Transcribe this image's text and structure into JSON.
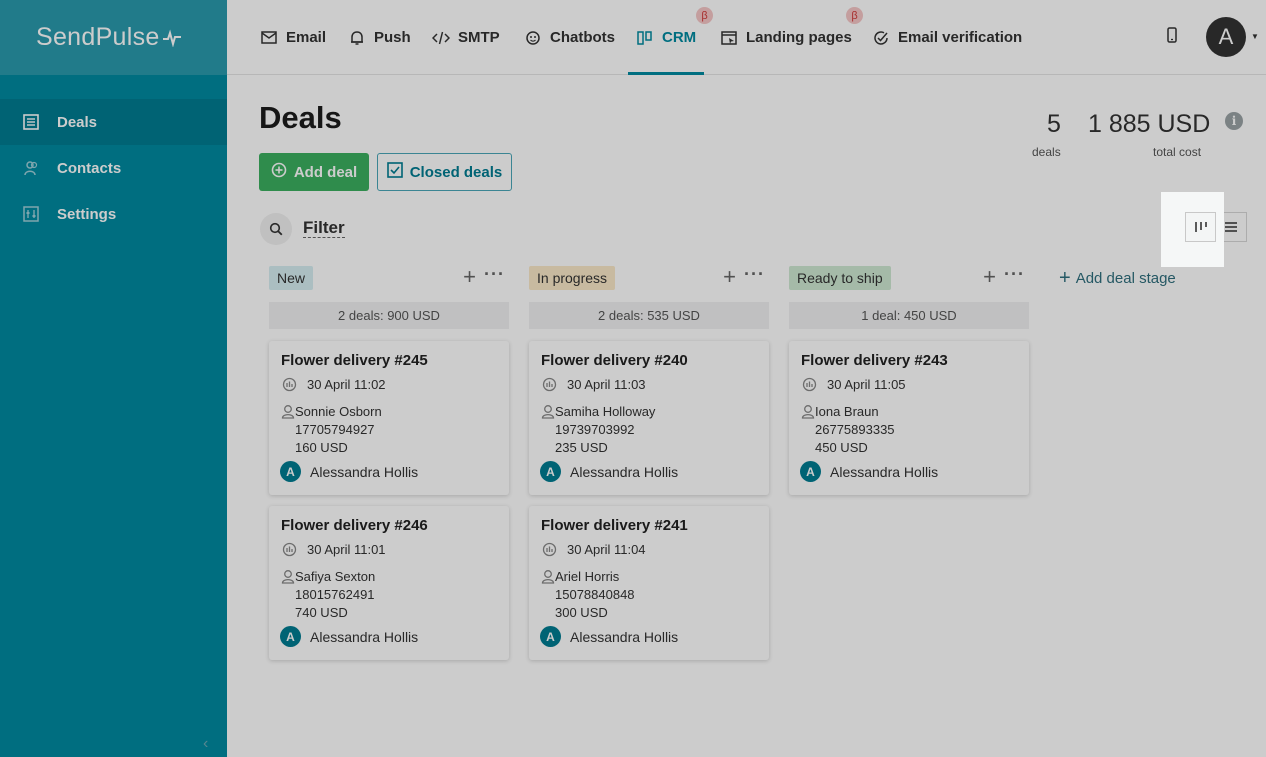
{
  "brand": {
    "name": "SendPulse"
  },
  "sidebar": {
    "items": [
      {
        "label": "Deals",
        "icon": "deals-list-icon"
      },
      {
        "label": "Contacts",
        "icon": "contacts-icon"
      },
      {
        "label": "Settings",
        "icon": "settings-sliders-icon"
      }
    ]
  },
  "topnav": {
    "tabs": [
      {
        "label": "Email",
        "icon": "envelope-icon"
      },
      {
        "label": "Push",
        "icon": "bell-icon"
      },
      {
        "label": "SMTP",
        "icon": "code-icon"
      },
      {
        "label": "Chatbots",
        "icon": "chatbot-icon"
      },
      {
        "label": "CRM",
        "icon": "crm-icon",
        "beta": "β"
      },
      {
        "label": "Landing pages",
        "icon": "landing-icon",
        "beta": "β"
      },
      {
        "label": "Email verification",
        "icon": "check-circle-icon"
      }
    ],
    "avatar_letter": "A"
  },
  "page": {
    "title": "Deals",
    "add_deal": "Add deal",
    "closed_deals": "Closed deals",
    "filter": "Filter",
    "add_stage": "Add deal stage"
  },
  "stats": {
    "deals_count": "5",
    "deals_label": "deals",
    "total_cost": "1 885 USD",
    "total_label": "total cost"
  },
  "columns": [
    {
      "name": "New",
      "color": "#d6eef2",
      "summary": "2 deals: 900 USD",
      "cards": [
        {
          "title": "Flower delivery #245",
          "date": "30 April 11:02",
          "contact": "Sonnie Osborn",
          "phone": "17705794927",
          "amount": "160 USD",
          "owner": "Alessandra Hollis",
          "owner_initial": "A"
        },
        {
          "title": "Flower delivery #246",
          "date": "30 April 11:01",
          "contact": "Safiya Sexton",
          "phone": "18015762491",
          "amount": "740 USD",
          "owner": "Alessandra Hollis",
          "owner_initial": "A"
        }
      ]
    },
    {
      "name": "In progress",
      "color": "#fbe9c8",
      "summary": "2 deals: 535 USD",
      "cards": [
        {
          "title": "Flower delivery #240",
          "date": "30 April 11:03",
          "contact": "Samiha Holloway",
          "phone": "19739703992",
          "amount": "235 USD",
          "owner": "Alessandra Hollis",
          "owner_initial": "A"
        },
        {
          "title": "Flower delivery #241",
          "date": "30 April 11:04",
          "contact": "Ariel Horris",
          "phone": "15078840848",
          "amount": "300 USD",
          "owner": "Alessandra Hollis",
          "owner_initial": "A"
        }
      ]
    },
    {
      "name": "Ready to ship",
      "color": "#cfe9d3",
      "summary": "1 deal: 450 USD",
      "cards": [
        {
          "title": "Flower delivery #243",
          "date": "30 April 11:05",
          "contact": "Iona Braun",
          "phone": "26775893335",
          "amount": "450 USD",
          "owner": "Alessandra Hollis",
          "owner_initial": "A"
        }
      ]
    }
  ],
  "colors": {
    "sidebar": "#008aa0",
    "accent": "#008aa0",
    "add_button": "#3bb05f"
  }
}
